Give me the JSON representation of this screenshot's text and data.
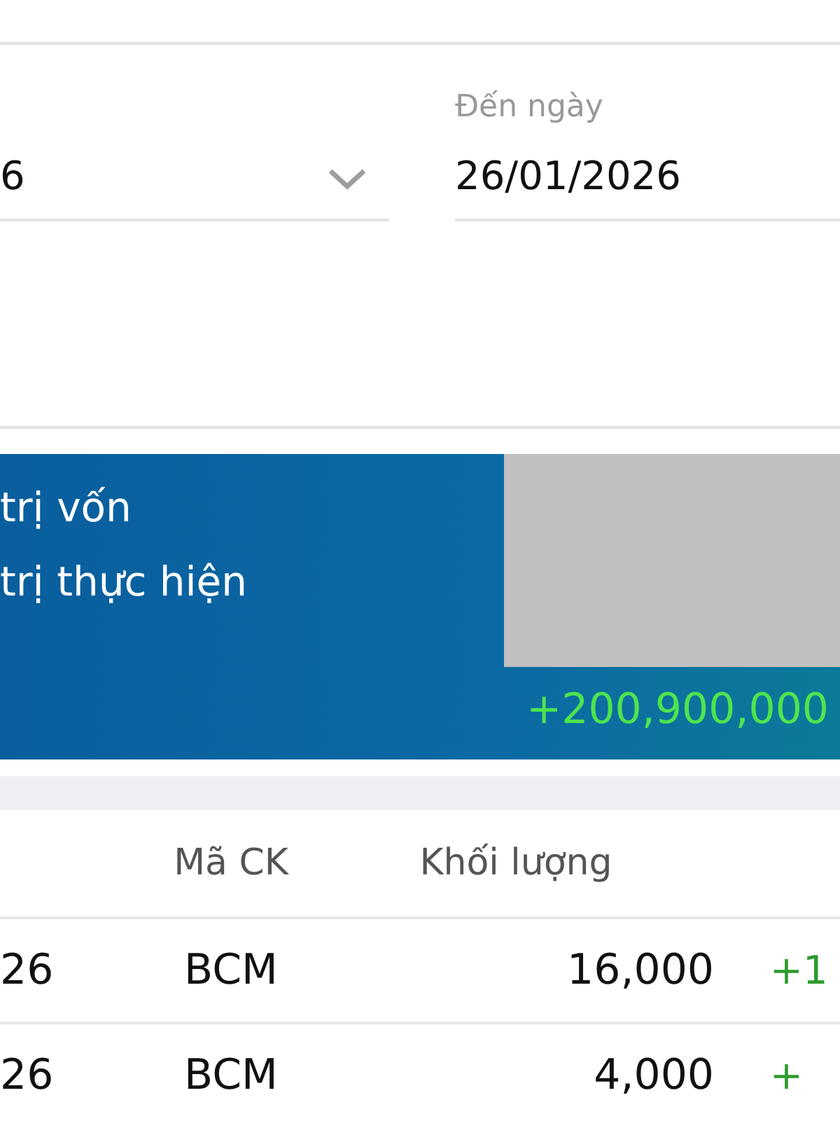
{
  "filter": {
    "from_date": {
      "value": "6"
    },
    "to_date": {
      "label": "Đến ngày",
      "value": "26/01/2026"
    }
  },
  "summary": {
    "labels": [
      "trị vốn",
      "trị thực hiện"
    ],
    "profit": "+200,900,000"
  },
  "table": {
    "header": {
      "symbol": "Mã CK",
      "volume": "Khối lượng"
    },
    "rows": [
      {
        "column_1": "26",
        "symbol": "BCM",
        "volume": "16,000",
        "column_4": "+1"
      },
      {
        "column_1": "26",
        "symbol": "BCM",
        "volume": "4,000",
        "column_4": "+"
      }
    ]
  }
}
